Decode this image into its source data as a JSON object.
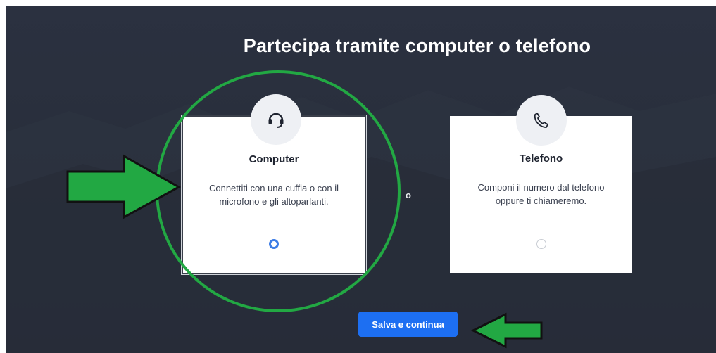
{
  "page": {
    "title": "Partecipa tramite computer o telefono",
    "separator": "o"
  },
  "options": {
    "computer": {
      "icon": "headset-icon",
      "title": "Computer",
      "description": "Connettiti con una cuffia o con il microfono e gli altoparlanti.",
      "selected": true
    },
    "phone": {
      "icon": "phone-icon",
      "title": "Telefono",
      "description": "Componi il numero dal telefono oppure ti chiameremo.",
      "selected": false
    }
  },
  "actions": {
    "save_label": "Salva e continua"
  },
  "annotations": {
    "circle": "green-circle",
    "arrows": [
      "green-arrow-right",
      "green-arrow-left"
    ],
    "color": "#22a843"
  },
  "colors": {
    "background": "#282e3b",
    "accent": "#1d6ff2",
    "radio_selected": "#3d7de6"
  }
}
